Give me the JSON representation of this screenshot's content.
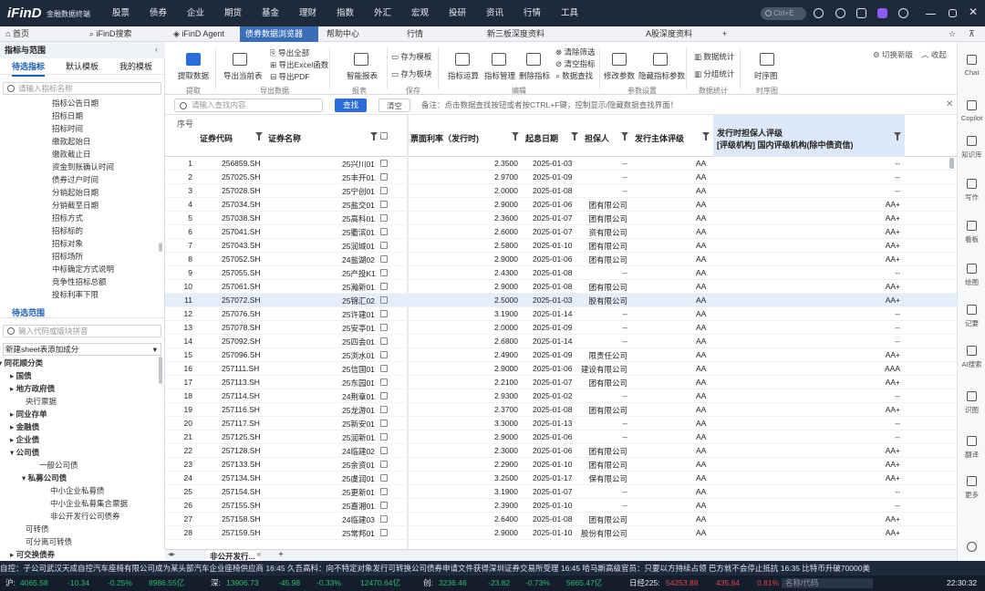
{
  "app": {
    "logo": "iFinD",
    "subtitle": "金融数据终端"
  },
  "menu": [
    "股票",
    "债券",
    "企业",
    "期货",
    "基金",
    "理财",
    "指数",
    "外汇",
    "宏观",
    "投研",
    "资讯",
    "行情",
    "工具"
  ],
  "top_search": "Ctrl+E",
  "colors": {
    "accent": "#3a6fb8",
    "topbar": "#1e2a3c",
    "up": "#e34646",
    "down": "#2ebd6b"
  },
  "tabs": {
    "home": "首页",
    "t1": "iFinD搜索",
    "t2": "iFinD Agent",
    "t3": "债券数据浏览器",
    "t4": "帮助中心",
    "t5": "行情",
    "t6": "新三板深度资料",
    "t7": "A股深度资料"
  },
  "left": {
    "header": "指标与范围",
    "tab_pending": "待选指标",
    "tab_default": "默认模板",
    "tab_mine": "我的模板",
    "search_ph": "请输入指标名称",
    "indicators": [
      "指标公告日期",
      "招标日期",
      "招标时间",
      "缴款起始日",
      "缴款截止日",
      "资金到账确认时间",
      "债券过户时间",
      "分销起始日期",
      "分销截至日期",
      "招标方式",
      "招标标的",
      "招标对象",
      "招标场所",
      "中标确定方式说明",
      "竞争性招标总额",
      "投标利率下限"
    ],
    "range_title": "待选范围",
    "range_ph": "输入代码或版块拼音",
    "sheet_select": "新建sheet表添加成分",
    "tree": [
      "同花顺分类",
      "国债",
      "地方政府债",
      "央行票据",
      "同业存单",
      "金融债",
      "企业债",
      "公司债",
      "一般公司债",
      "私募公司债",
      "中小企业私募债",
      "中小企业私募集合票据",
      "非公开发行公司债券",
      "可转债",
      "可分离可转债",
      "可交换债券"
    ]
  },
  "toolbar": {
    "fetch": "提取数据",
    "export_sheet": "导出当前表",
    "export_all": "导出全部",
    "export_excel": "导出Excel函数",
    "export_pdf": "导出PDF",
    "smart_report": "智能报表",
    "save_template": "存为模板",
    "save_block": "存为板块",
    "calc": "指标运算",
    "manage": "指标管理",
    "delete": "删除指标",
    "clear_filter": "清除筛选",
    "clear_indicators": "清空指标",
    "data_find": "数据查找",
    "edit_params": "修改参数",
    "hidden_params": "隐藏指标参数",
    "stats": "数据统计",
    "group_stats": "分组统计",
    "timeline": "时序图",
    "switch_new": "切换新版",
    "collapse": "收起",
    "groups": {
      "extract": "提取",
      "export": "导出数据",
      "report": "报表",
      "save": "保存",
      "edit": "编辑",
      "params": "参数设置",
      "stat": "数据统计",
      "series": "时序图"
    }
  },
  "filter": {
    "placeholder": "请输入查找内容",
    "find": "查找",
    "clear": "清空",
    "note": "备注：点击数据查找按钮或者按CTRL+F键，控制显示/隐藏数据查找界面！"
  },
  "table": {
    "seq": "序号",
    "h_code": "证券代码",
    "h_name": "证券名称",
    "h_rate": "票面利率（发行时)",
    "h_date": "起息日期",
    "h_guar": "担保人",
    "h_rating": "发行主体评级",
    "h_g1": "发行时担保人评级",
    "h_g2": "[评级机构] 国内评级机构(除中债资信)",
    "rows": [
      [
        "1",
        "256859.SH",
        "25兴川01",
        "2.3500",
        "2025-01-03",
        "--",
        "AA",
        "--"
      ],
      [
        "2",
        "257025.SH",
        "25丰开01",
        "2.9700",
        "2025-01-09",
        "--",
        "AA",
        "--"
      ],
      [
        "3",
        "257028.SH",
        "25宁创01",
        "2.0000",
        "2025-01-08",
        "--",
        "AA",
        "--"
      ],
      [
        "4",
        "257034.SH",
        "25盐交01",
        "2.9000",
        "2025-01-06",
        "团有限公司",
        "AA",
        "AA+"
      ],
      [
        "5",
        "257038.SH",
        "25高科01",
        "2.3600",
        "2025-01-07",
        "团有限公司",
        "AA",
        "AA+"
      ],
      [
        "6",
        "257041.SH",
        "25衢滨01",
        "2.6000",
        "2025-01-07",
        "资有限公司",
        "AA",
        "AA+"
      ],
      [
        "7",
        "257043.SH",
        "25润城01",
        "2.5800",
        "2025-01-10",
        "团有限公司",
        "AA",
        "AA+"
      ],
      [
        "8",
        "257052.SH",
        "24盐湖02",
        "2.9000",
        "2025-01-06",
        "团有限公司",
        "AA",
        "AA+"
      ],
      [
        "9",
        "257055.SH",
        "25产投K1",
        "2.4300",
        "2025-01-08",
        "--",
        "AA",
        "--"
      ],
      [
        "10",
        "257061.SH",
        "25瀚新01",
        "2.9000",
        "2025-01-08",
        "团有限公司",
        "AA",
        "AA+"
      ],
      [
        "11",
        "257072.SH",
        "25锦汇02",
        "2.5000",
        "2025-01-03",
        "股有限公司",
        "AA",
        "AA+"
      ],
      [
        "12",
        "257076.SH",
        "25许建01",
        "3.1900",
        "2025-01-14",
        "--",
        "AA",
        "--"
      ],
      [
        "13",
        "257078.SH",
        "25安亭01",
        "2.0000",
        "2025-01-09",
        "--",
        "AA",
        "--"
      ],
      [
        "14",
        "257092.SH",
        "25四会01",
        "2.6800",
        "2025-01-14",
        "--",
        "AA",
        "--"
      ],
      [
        "15",
        "257096.SH",
        "25浏水01",
        "2.4900",
        "2025-01-09",
        "限责任公司",
        "AA",
        "AA+"
      ],
      [
        "16",
        "257111.SH",
        "25信国01",
        "2.9000",
        "2025-01-06",
        "建设有限公司",
        "AA",
        "AAA"
      ],
      [
        "17",
        "257113.SH",
        "25东园01",
        "2.2100",
        "2025-01-07",
        "团有限公司",
        "AA",
        "AA+"
      ],
      [
        "18",
        "257114.SH",
        "24荆章01",
        "2.9300",
        "2025-01-02",
        "--",
        "AA",
        "--"
      ],
      [
        "19",
        "257116.SH",
        "25龙游01",
        "2.3700",
        "2025-01-08",
        "团有限公司",
        "AA",
        "AA+"
      ],
      [
        "20",
        "257117.SH",
        "25新安01",
        "3.3000",
        "2025-01-13",
        "--",
        "AA",
        "--"
      ],
      [
        "21",
        "257125.SH",
        "25润新01",
        "2.9000",
        "2025-01-06",
        "--",
        "AA",
        "--"
      ],
      [
        "22",
        "257128.SH",
        "24临建02",
        "2.3000",
        "2025-01-06",
        "团有限公司",
        "AA",
        "AA+"
      ],
      [
        "23",
        "257133.SH",
        "25余资01",
        "2.2900",
        "2025-01-10",
        "团有限公司",
        "AA",
        "AA+"
      ],
      [
        "24",
        "257134.SH",
        "25虞润01",
        "3.2500",
        "2025-01-17",
        "保有限公司",
        "AA",
        "AA+"
      ],
      [
        "25",
        "257154.SH",
        "25更新01",
        "3.1900",
        "2025-01-07",
        "--",
        "AA",
        "--"
      ],
      [
        "26",
        "257155.SH",
        "25嘉湘01",
        "2.3900",
        "2025-01-10",
        "--",
        "AA",
        "--"
      ],
      [
        "27",
        "257158.SH",
        "24临建03",
        "2.6400",
        "2025-01-08",
        "团有限公司",
        "AA",
        "AA+"
      ],
      [
        "28",
        "257159.SH",
        "25常邦01",
        "2.9000",
        "2025-01-10",
        "股份有限公司",
        "AA",
        "AA+"
      ]
    ]
  },
  "sheet_tab": "非公开发行...",
  "right": [
    "Chat",
    "Copilot",
    "知识库",
    "写作",
    "看板",
    "绘图",
    "记要",
    "AI搜索",
    "识图",
    "翻译",
    "更多"
  ],
  "ticker": "自控：子公司武汉天成自控汽车座椅有限公司成为某头部汽车企业座椅供应商    16:45 久吾高科：向不特定对象发行可转换公司债券申请文件获得深圳证券交易所受理    16:45 哈马斯高级官员：只要以方持续占领 巴方就不会停止抵抗    16:35 比特币升破70000美",
  "status": {
    "sh": "沪:",
    "sh_val": "4065.58",
    "sh_chg": "-10.34",
    "sh_pct": "-0.25%",
    "sh_amt": "8986.55亿",
    "sz": "深:",
    "sz_val": "13906.73",
    "sz_chg": "-45.98",
    "sz_pct": "-0.33%",
    "sz_amt": "12470.64亿",
    "cy": "创:",
    "cy_val": "3236.46",
    "cy_chg": "-23.82",
    "cy_pct": "-0.73%",
    "cy_amt": "5665.47亿",
    "nk": "日经225:",
    "nk_val": "54253.88",
    "nk_chg": "435.64",
    "nk_pct": "0.81%",
    "code_ph": "名称/代码",
    "time": "22:30:32"
  }
}
